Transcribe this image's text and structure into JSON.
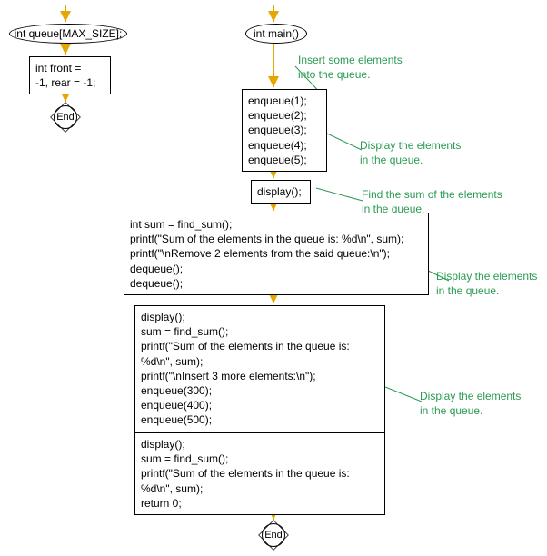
{
  "left": {
    "entry": "int queue[MAX_SIZE];",
    "init": "int front =\n-1, rear = -1;",
    "end": "End"
  },
  "right": {
    "entry": "int main()",
    "note1": "Insert some elements\ninto the queue.",
    "enqueue1": "enqueue(1);\nenqueue(2);\nenqueue(3);\nenqueue(4);\nenqueue(5);",
    "note2": "Display the elements\nin the queue.",
    "display1": "display();",
    "note3": "Find the sum of the elements\nin the queue.",
    "block2": "int sum = find_sum();\nprintf(\"Sum of the elements in the queue is: %d\\n\", sum);\nprintf(\"\\nRemove 2 elements from the said queue:\\n\");\ndequeue();\ndequeue();",
    "note4": "Display the elements\nin the queue.",
    "block3": "display();\nsum = find_sum();\nprintf(\"Sum of the elements in the queue is:\n%d\\n\", sum);\nprintf(\"\\nInsert 3 more elements:\\n\");\nenqueue(300);\nenqueue(400);\nenqueue(500);",
    "note5": "Display the elements\nin the queue.",
    "block4": "display();\nsum = find_sum();\nprintf(\"Sum of the elements in the queue is:\n%d\\n\", sum);\nreturn 0;",
    "end": "End"
  },
  "chart_data": {
    "type": "flowchart",
    "columns": [
      {
        "name": "left",
        "nodes": [
          {
            "id": "l-start",
            "type": "start-arrow"
          },
          {
            "id": "l-entry",
            "type": "terminator",
            "text": "int queue[MAX_SIZE];"
          },
          {
            "id": "l-init",
            "type": "process",
            "text": "int front = -1, rear = -1;"
          },
          {
            "id": "l-end",
            "type": "end",
            "text": "End"
          }
        ],
        "edges": [
          [
            "l-start",
            "l-entry"
          ],
          [
            "l-entry",
            "l-init"
          ],
          [
            "l-init",
            "l-end"
          ]
        ]
      },
      {
        "name": "right",
        "nodes": [
          {
            "id": "r-start",
            "type": "start-arrow"
          },
          {
            "id": "r-entry",
            "type": "terminator",
            "text": "int main()"
          },
          {
            "id": "r-enq",
            "type": "process",
            "text": "enqueue(1); enqueue(2); enqueue(3); enqueue(4); enqueue(5);",
            "comment": "Insert some elements into the queue."
          },
          {
            "id": "r-disp1",
            "type": "process",
            "text": "display();",
            "comment": "Display the elements in the queue."
          },
          {
            "id": "r-b2",
            "type": "process",
            "text": "int sum = find_sum(); printf(\"Sum of the elements in the queue is: %d\\n\", sum); printf(\"\\nRemove 2 elements from the said queue:\\n\"); dequeue(); dequeue();",
            "comment_in": "Find the sum of the elements in the queue."
          },
          {
            "id": "r-b3",
            "type": "process",
            "text": "display(); sum = find_sum(); printf(\"Sum of the elements in the queue is: %d\\n\", sum); printf(\"\\nInsert 3 more elements:\\n\"); enqueue(300); enqueue(400); enqueue(500);",
            "comment": "Display the elements in the queue."
          },
          {
            "id": "r-b4",
            "type": "process",
            "text": "display(); sum = find_sum(); printf(\"Sum of the elements in the queue is: %d\\n\", sum); return 0;",
            "comment": "Display the elements in the queue."
          },
          {
            "id": "r-end",
            "type": "end",
            "text": "End"
          }
        ],
        "edges": [
          [
            "r-start",
            "r-entry"
          ],
          [
            "r-entry",
            "r-enq"
          ],
          [
            "r-enq",
            "r-disp1"
          ],
          [
            "r-disp1",
            "r-b2"
          ],
          [
            "r-b2",
            "r-b3"
          ],
          [
            "r-b3",
            "r-b4"
          ],
          [
            "r-b4",
            "r-end"
          ]
        ]
      }
    ]
  }
}
